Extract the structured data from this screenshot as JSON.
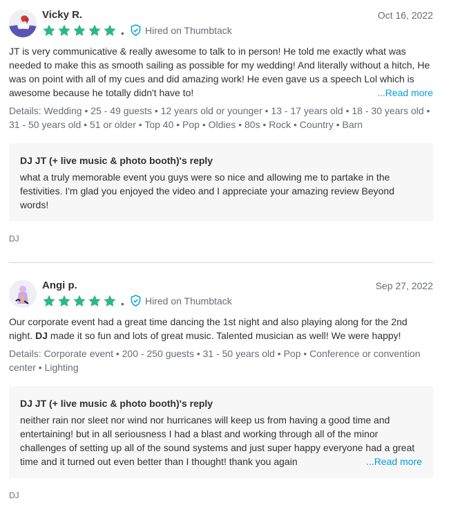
{
  "reviews": [
    {
      "name": "Vicky R.",
      "date": "Oct 16, 2022",
      "rating": 5,
      "hired_label": "Hired on Thumbtack",
      "text": "JT is very communicative & really awesome to talk to in person! He told me exactly what was needed to make this as smooth sailing as possible for my wedding! And literally without a hitch, He was on point with all of my cues and did amazing work! He even gave us a speech Lol which is awesome because he totally didn't have to!",
      "read_more": "...Read more",
      "details": "Details: Wedding • 25 - 49 guests • 12 years old or younger • 13 - 17 years old • 18 - 30 years old • 31 - 50 years old • 51 or older • Top 40 • Pop • Oldies • 80s • Rock • Country • Barn",
      "reply_title": "DJ JT (+ live music & photo booth)'s reply",
      "reply_text": "what a truly memorable event you guys were so nice and allowing me to partake in the festivities. I'm glad you enjoyed the video and I appreciate your amazing review Beyond words!",
      "category": "DJ"
    },
    {
      "name": "Angi p.",
      "date": "Sep 27, 2022",
      "rating": 5,
      "hired_label": "Hired on Thumbtack",
      "text_before": "Our corporate event had a great time dancing the 1st night and also playing along for the 2nd night. ",
      "text_bold": "DJ",
      "text_after": " made it so fun and lots of great music. Talented musician as well! We were happy!",
      "details": "Details: Corporate event • 200 - 250 guests • 31 - 50 years old • Pop • Conference or convention center • Lighting",
      "reply_title": "DJ JT (+ live music & photo booth)'s reply",
      "reply_text": "neither rain nor sleet nor wind nor hurricanes will keep us from having a good time and entertaining! but in all seriousness I had a blast and working through all of the minor challenges of setting up all of the sound systems and just super happy everyone had a great time and it turned out even better than I thought! thank you again",
      "read_more": "...Read more",
      "category": "DJ"
    }
  ],
  "colors": {
    "star": "#2db783",
    "link": "#009fd9",
    "shield": "#009fd9"
  },
  "icons": {
    "star": "star-icon",
    "shield": "shield-check-icon"
  }
}
